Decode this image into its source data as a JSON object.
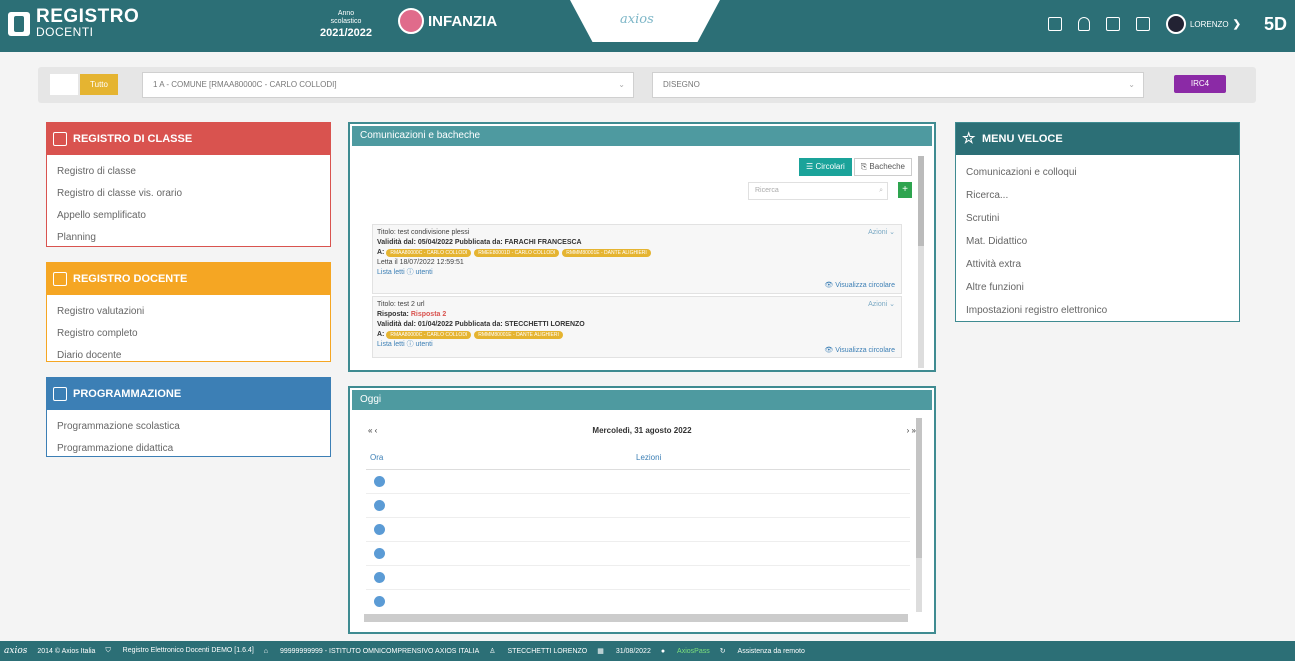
{
  "header": {
    "brand_line1": "REGISTRO",
    "brand_line2": "DOCENTI",
    "year_label": "Anno\nscolastico",
    "year_value": "2021/2022",
    "section": "INFANZIA",
    "axios_tab": "axios",
    "user_name": "LORENZO",
    "initials": "5D"
  },
  "filter": {
    "tutto": "Tutto",
    "class_select": "1 A - COMUNE [RMAA80000C - CARLO COLLODI]",
    "subject_select": "DISEGNO",
    "button": "IRC4"
  },
  "registro_classe": {
    "title": "REGISTRO DI CLASSE",
    "items": [
      "Registro di classe",
      "Registro di classe vis. orario",
      "Appello semplificato",
      "Planning"
    ]
  },
  "registro_docente": {
    "title": "REGISTRO DOCENTE",
    "items": [
      "Registro valutazioni",
      "Registro completo",
      "Diario docente"
    ]
  },
  "programmazione": {
    "title": "PROGRAMMAZIONE",
    "items": [
      "Programmazione scolastica",
      "Programmazione didattica"
    ]
  },
  "comunicazioni": {
    "title": "Comunicazioni e bacheche",
    "tab_circolari": "Circolari",
    "tab_bacheche": "Bacheche",
    "search_placeholder": "Ricerca",
    "add": "+",
    "cards": [
      {
        "title": "Titolo: test condivisione plessi",
        "validita": "Validità dal: 05/04/2022 Pubblicata da: FARACHI FRANCESCA",
        "a_label": "A:",
        "chips": [
          "RMAA80000C - CARLO COLLODI",
          "RMEE80001D - CARLO COLLODI",
          "RMMM80001E - DANTE ALIGHIERI"
        ],
        "letto": "Letta il 18/07/2022 12:59:51",
        "lista": "Lista letti",
        "azioni": "Azioni",
        "visualizza": "Visualizza circolare"
      },
      {
        "title": "Titolo: test 2 url",
        "risposta_label": "Risposta:",
        "risposta_value": "Risposta 2",
        "validita": "Validità dal: 01/04/2022 Pubblicata da: STECCHETTI LORENZO",
        "a_label": "A:",
        "chips": [
          "RMAA80000C - CARLO COLLODI",
          "RMMM80001E - DANTE ALIGHIERI"
        ],
        "lista": "Lista letti",
        "azioni": "Azioni",
        "visualizza": "Visualizza circolare"
      }
    ]
  },
  "oggi": {
    "title": "Oggi",
    "nav_left": "« ‹",
    "date": "Mercoledì, 31 agosto 2022",
    "nav_right": "› »",
    "col_ora": "Ora",
    "col_lezioni": "Lezioni"
  },
  "menu_veloce": {
    "title": "MENU VELOCE",
    "items": [
      "Comunicazioni e colloqui",
      "Ricerca...",
      "Scrutini",
      "Mat. Didattico",
      "Attività extra",
      "Altre funzioni",
      "Impostazioni registro elettronico"
    ]
  },
  "footer": {
    "logo": "axios",
    "copyright": "2014 © Axios Italia",
    "version": "Registro Elettronico Docenti DEMO [1.6.4]",
    "school": "99999999999 - ISTITUTO OMNICOMPRENSIVO AXIOS ITALIA",
    "user": "STECCHETTI LORENZO",
    "date": "31/08/2022",
    "axiospass": "AxiosPass",
    "assistenza": "Assistenza da remoto"
  }
}
